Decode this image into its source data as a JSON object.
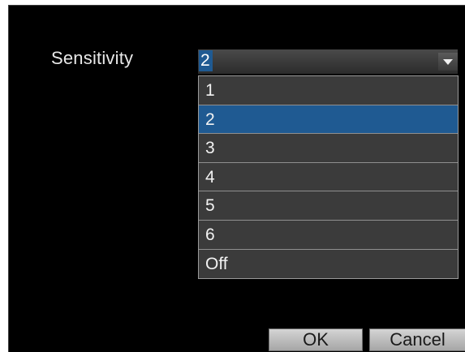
{
  "dialog": {
    "sensitivity_label": "Sensitivity",
    "select": {
      "value": "2",
      "icon": "chevron-down-icon"
    },
    "options": [
      {
        "label": "1",
        "selected": false
      },
      {
        "label": "2",
        "selected": true
      },
      {
        "label": "3",
        "selected": false
      },
      {
        "label": "4",
        "selected": false
      },
      {
        "label": "5",
        "selected": false
      },
      {
        "label": "6",
        "selected": false
      },
      {
        "label": "Off",
        "selected": false
      }
    ],
    "ok_label": "OK",
    "cancel_label": "Cancel"
  },
  "colors": {
    "background": "#000000",
    "highlight": "#1f5a92",
    "list_bg": "#3b3b3b",
    "button_bg": "#bdbdbd"
  }
}
